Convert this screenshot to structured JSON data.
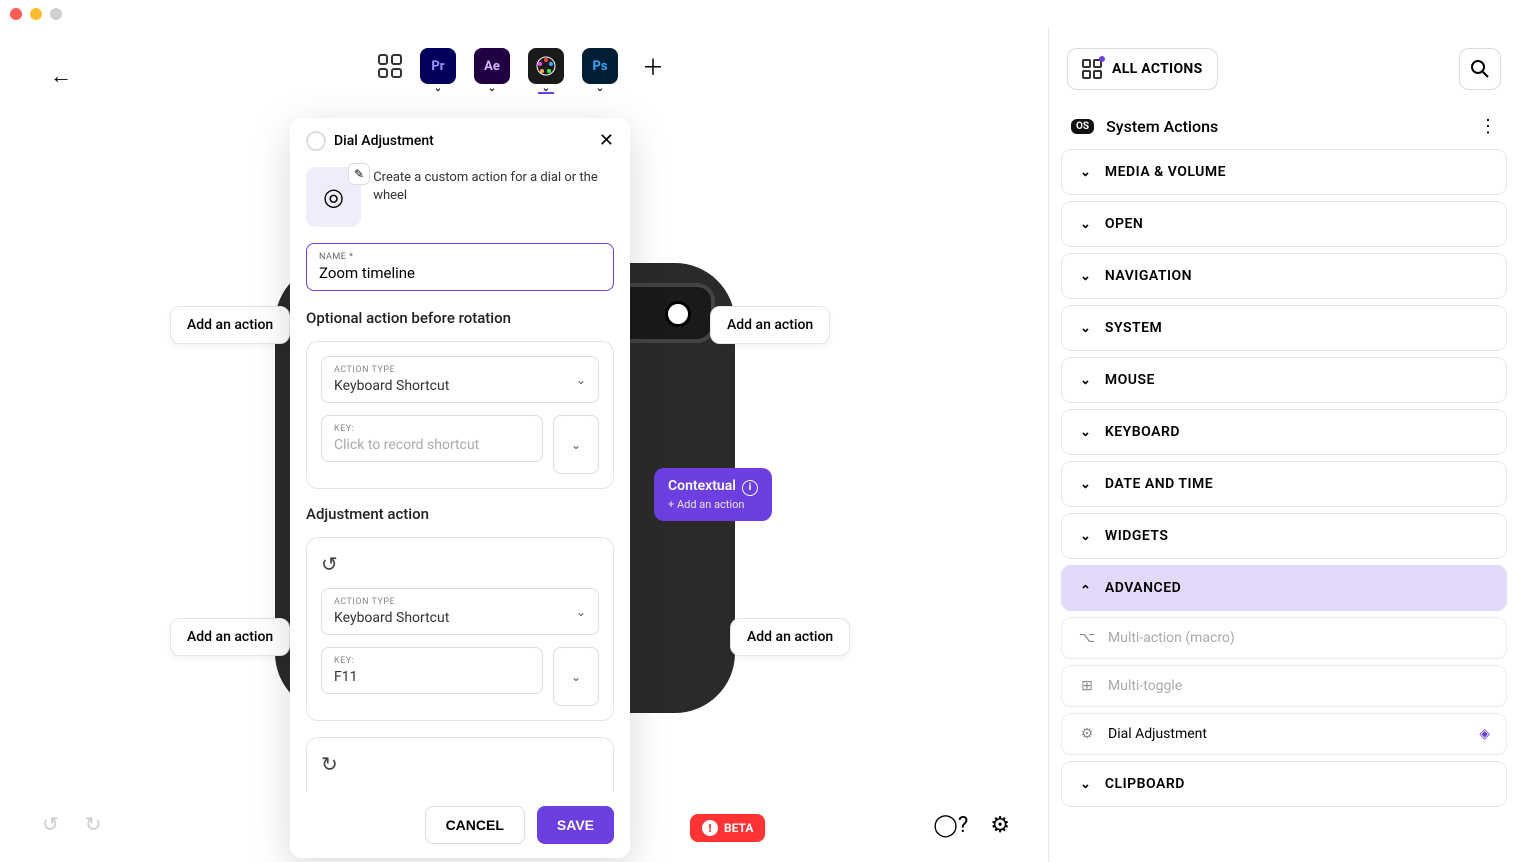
{
  "window": {
    "title_dots": true
  },
  "topbar": {
    "apps": [
      "Pr",
      "Ae",
      "DV",
      "Ps"
    ],
    "active_index": 2
  },
  "pills": {
    "add_action": "Add an action",
    "contextual": "Contextual",
    "contextual_sub": "+ Add an action"
  },
  "beta": "BETA",
  "modal": {
    "title": "Dial Adjustment",
    "desc": "Create a custom action for a dial or the wheel",
    "name_label": "NAME  *",
    "name_value": "Zoom timeline",
    "section_optional": "Optional action before rotation",
    "action_type_label": "ACTION TYPE",
    "action_type_value": "Keyboard Shortcut",
    "key_label": "KEY:",
    "key_placeholder": "Click to record shortcut",
    "section_adjust": "Adjustment action",
    "key_value_ccw": "F11",
    "cancel": "CANCEL",
    "save": "SAVE"
  },
  "right": {
    "all_actions": "ALL ACTIONS",
    "system_actions": "System Actions",
    "os_badge": "OS",
    "categories": [
      {
        "label": "MEDIA & VOLUME",
        "open": false
      },
      {
        "label": "OPEN",
        "open": false
      },
      {
        "label": "NAVIGATION",
        "open": false
      },
      {
        "label": "SYSTEM",
        "open": false
      },
      {
        "label": "MOUSE",
        "open": false
      },
      {
        "label": "KEYBOARD",
        "open": false
      },
      {
        "label": "DATE AND TIME",
        "open": false
      },
      {
        "label": "WIDGETS",
        "open": false
      },
      {
        "label": "ADVANCED",
        "open": true,
        "items": [
          {
            "label": "Multi-action (macro)",
            "disabled": true,
            "icon": "⌥"
          },
          {
            "label": "Multi-toggle",
            "disabled": true,
            "icon": "⊞"
          },
          {
            "label": "Dial Adjustment",
            "disabled": false,
            "icon": "⚙",
            "trail": "◈"
          }
        ]
      },
      {
        "label": "CLIPBOARD",
        "open": false
      }
    ]
  }
}
